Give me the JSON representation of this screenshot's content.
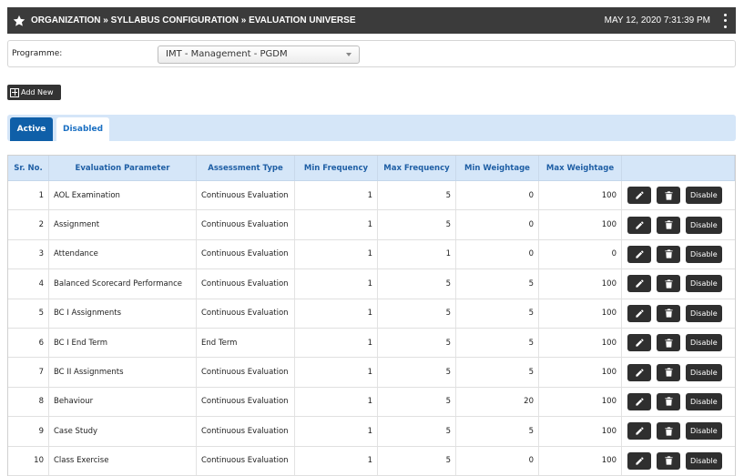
{
  "header": {
    "title": "ORGANIZATION » SYLLABUS CONFIGURATION » EVALUATION UNIVERSE",
    "datetime": "MAY 12, 2020  7:31:39 PM"
  },
  "programme": {
    "label": "Programme:",
    "selected": "IMT - Management - PGDM"
  },
  "toolbar": {
    "add_new_label": "Add New"
  },
  "tabs": [
    {
      "label": "Active",
      "active": true
    },
    {
      "label": "Disabled",
      "active": false
    }
  ],
  "table": {
    "columns": [
      "Sr. No.",
      "Evaluation Parameter",
      "Assessment Type",
      "Min Frequency",
      "Max Frequency",
      "Min Weightage",
      "Max Weightage",
      ""
    ],
    "action_disable_label": "Disable",
    "rows": [
      {
        "sr": "1",
        "param": "AOL Examination",
        "type": "Continuous Evaluation",
        "min_freq": "1",
        "max_freq": "5",
        "min_w": "0",
        "max_w": "100"
      },
      {
        "sr": "2",
        "param": "Assignment",
        "type": "Continuous Evaluation",
        "min_freq": "1",
        "max_freq": "5",
        "min_w": "0",
        "max_w": "100"
      },
      {
        "sr": "3",
        "param": "Attendance",
        "type": "Continuous Evaluation",
        "min_freq": "1",
        "max_freq": "1",
        "min_w": "0",
        "max_w": "0"
      },
      {
        "sr": "4",
        "param": "Balanced Scorecard Performance",
        "type": "Continuous Evaluation",
        "min_freq": "1",
        "max_freq": "5",
        "min_w": "5",
        "max_w": "100"
      },
      {
        "sr": "5",
        "param": "BC I Assignments",
        "type": "Continuous Evaluation",
        "min_freq": "1",
        "max_freq": "5",
        "min_w": "5",
        "max_w": "100"
      },
      {
        "sr": "6",
        "param": "BC I End Term",
        "type": "End Term",
        "min_freq": "1",
        "max_freq": "5",
        "min_w": "5",
        "max_w": "100"
      },
      {
        "sr": "7",
        "param": "BC II Assignments",
        "type": "Continuous Evaluation",
        "min_freq": "1",
        "max_freq": "5",
        "min_w": "5",
        "max_w": "100"
      },
      {
        "sr": "8",
        "param": "Behaviour",
        "type": "Continuous Evaluation",
        "min_freq": "1",
        "max_freq": "5",
        "min_w": "20",
        "max_w": "100"
      },
      {
        "sr": "9",
        "param": "Case Study",
        "type": "Continuous Evaluation",
        "min_freq": "1",
        "max_freq": "5",
        "min_w": "5",
        "max_w": "100"
      },
      {
        "sr": "10",
        "param": "Class Exercise",
        "type": "Continuous Evaluation",
        "min_freq": "1",
        "max_freq": "5",
        "min_w": "0",
        "max_w": "100"
      }
    ]
  }
}
